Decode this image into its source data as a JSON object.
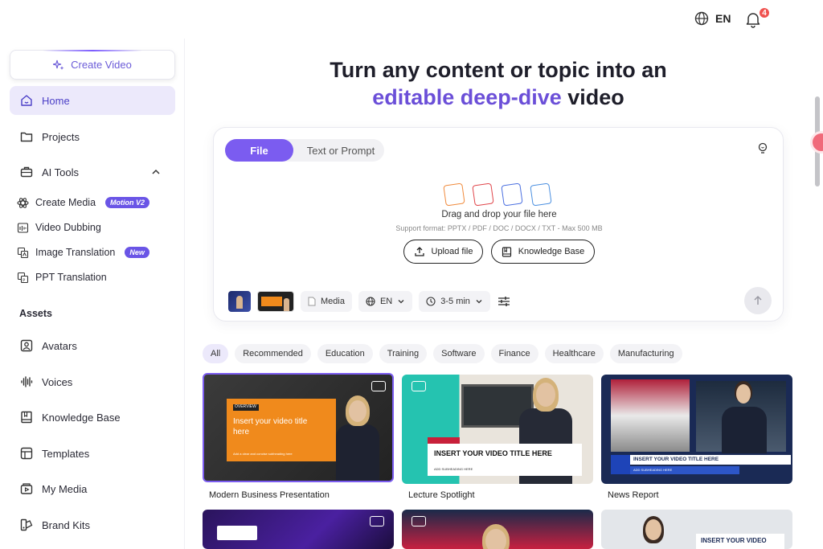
{
  "header": {
    "language": "EN",
    "notification_count": "4"
  },
  "sidebar": {
    "create_label": "Create Video",
    "items": [
      {
        "label": "Home"
      },
      {
        "label": "Projects"
      },
      {
        "label": "AI Tools"
      }
    ],
    "tools": [
      {
        "label": "Create Media",
        "badge": "Motion V2"
      },
      {
        "label": "Video Dubbing"
      },
      {
        "label": "Image Translation",
        "badge": "New"
      },
      {
        "label": "PPT Translation"
      }
    ],
    "assets_label": "Assets",
    "assets": [
      {
        "label": "Avatars"
      },
      {
        "label": "Voices"
      },
      {
        "label": "Knowledge Base"
      },
      {
        "label": "Templates"
      },
      {
        "label": "My Media"
      },
      {
        "label": "Brand Kits"
      }
    ]
  },
  "hero": {
    "line1": "Turn any content or topic into an",
    "line2_highlight": "editable deep-dive",
    "line2_rest": " video"
  },
  "composer": {
    "tab_file": "File",
    "tab_text": "Text or Prompt",
    "drop_text": "Drag and drop your file here",
    "support_text": "Support format: PPTX / PDF / DOC / DOCX / TXT - Max 500 MB",
    "upload_label": "Upload file",
    "kb_label": "Knowledge Base",
    "media_label": "Media",
    "language": "EN",
    "duration": "3-5 min"
  },
  "categories": [
    "All",
    "Recommended",
    "Education",
    "Training",
    "Software",
    "Finance",
    "Healthcare",
    "Manufacturing"
  ],
  "templates": [
    {
      "name": "Modern Business Presentation",
      "tag": "OVERVIEW",
      "title": "Insert your video title here",
      "sub": "Add a clear and concise subheading here"
    },
    {
      "name": "Lecture Spotlight",
      "title": "INSERT YOUR VIDEO TITLE HERE",
      "sub": "ADD SUBHEADING HERE"
    },
    {
      "name": "News Report",
      "title": "INSERT YOUR VIDEO TITLE HERE",
      "sub": "ADD SUBHEADING HERE"
    },
    {
      "name": "",
      "title": ""
    },
    {
      "name": "",
      "title": ""
    },
    {
      "name": "",
      "title": "INSERT YOUR VIDEO"
    }
  ],
  "colors": {
    "accent": "#7b5cf0",
    "active_nav_bg": "#ece9fb",
    "badge_red": "#f0524f"
  }
}
